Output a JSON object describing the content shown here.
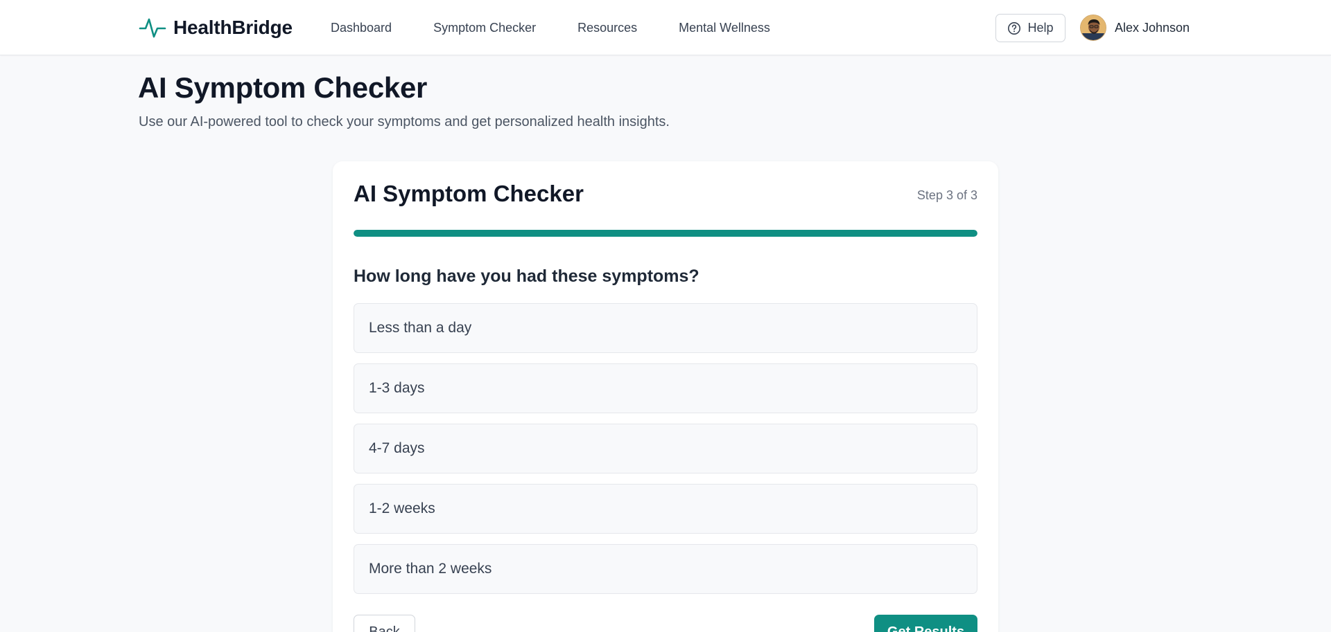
{
  "brand": {
    "name": "HealthBridge",
    "icon": "heartbeat-pulse-icon",
    "accent": "#0f8f83"
  },
  "nav": {
    "items": [
      {
        "label": "Dashboard"
      },
      {
        "label": "Symptom Checker"
      },
      {
        "label": "Resources"
      },
      {
        "label": "Mental Wellness"
      }
    ]
  },
  "header": {
    "help_label": "Help",
    "help_icon": "help-circle-icon",
    "user_name": "Alex Johnson",
    "avatar_icon": "user-avatar"
  },
  "page": {
    "title": "AI Symptom Checker",
    "subtitle": "Use our AI-powered tool to check your symptoms and get personalized health insights."
  },
  "card": {
    "title": "AI Symptom Checker",
    "step_label": "Step 3 of 3",
    "progress": 1.0,
    "question": "How long have you had these symptoms?",
    "options": [
      {
        "label": "Less than a day"
      },
      {
        "label": "1-3 days"
      },
      {
        "label": "4-7 days"
      },
      {
        "label": "1-2 weeks"
      },
      {
        "label": "More than 2 weeks"
      }
    ],
    "back_label": "Back",
    "submit_label": "Get Results"
  }
}
